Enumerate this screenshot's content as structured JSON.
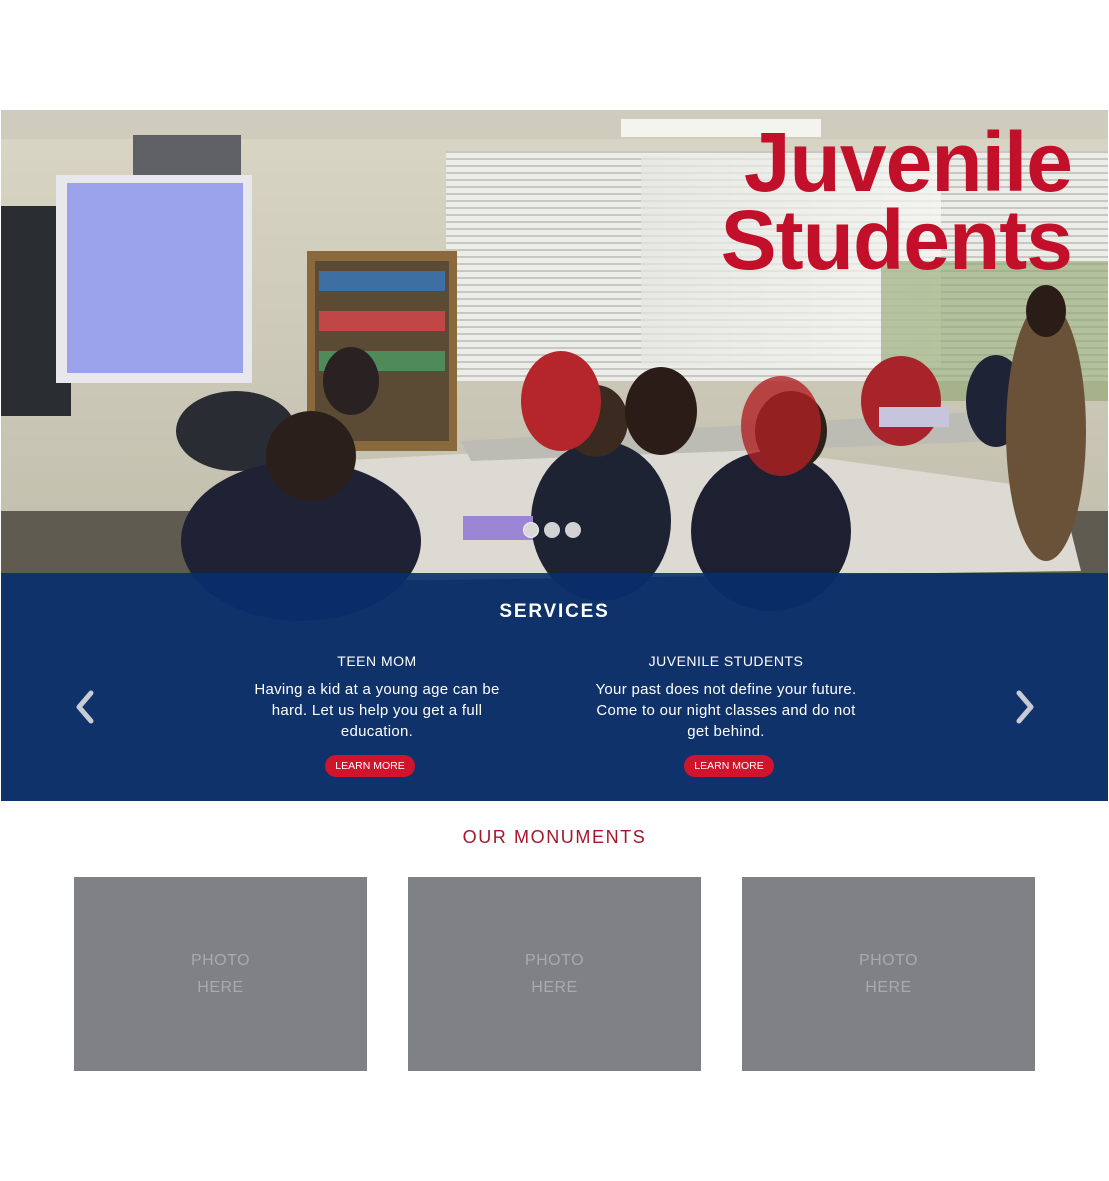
{
  "hero": {
    "title_line1": "Juvenile",
    "title_line2": "Students",
    "title_color": "#c2102a",
    "slides": 3,
    "active_slide": 1
  },
  "services": {
    "heading": "SERVICES",
    "background": "#082d6e",
    "cards": [
      {
        "title": "TEEN MOM",
        "text": "Having a kid at a young age can be hard. Let us help you get a full education.",
        "button": "LEARN MORE"
      },
      {
        "title": "JUVENILE STUDENTS",
        "text": "Your past does not define your future. Come to our night classes and do not get behind.",
        "button": "LEARN MORE"
      }
    ],
    "prev_icon": "chevron-left-icon",
    "next_icon": "chevron-right-icon"
  },
  "monuments": {
    "heading": "OUR MONUMENTS",
    "photos": [
      {
        "line1": "PHOTO",
        "line2": "HERE"
      },
      {
        "line1": "PHOTO",
        "line2": "HERE"
      },
      {
        "line1": "PHOTO",
        "line2": "HERE"
      }
    ]
  },
  "colors": {
    "accent_red": "#d0142c",
    "placeholder_gray": "#808185"
  }
}
